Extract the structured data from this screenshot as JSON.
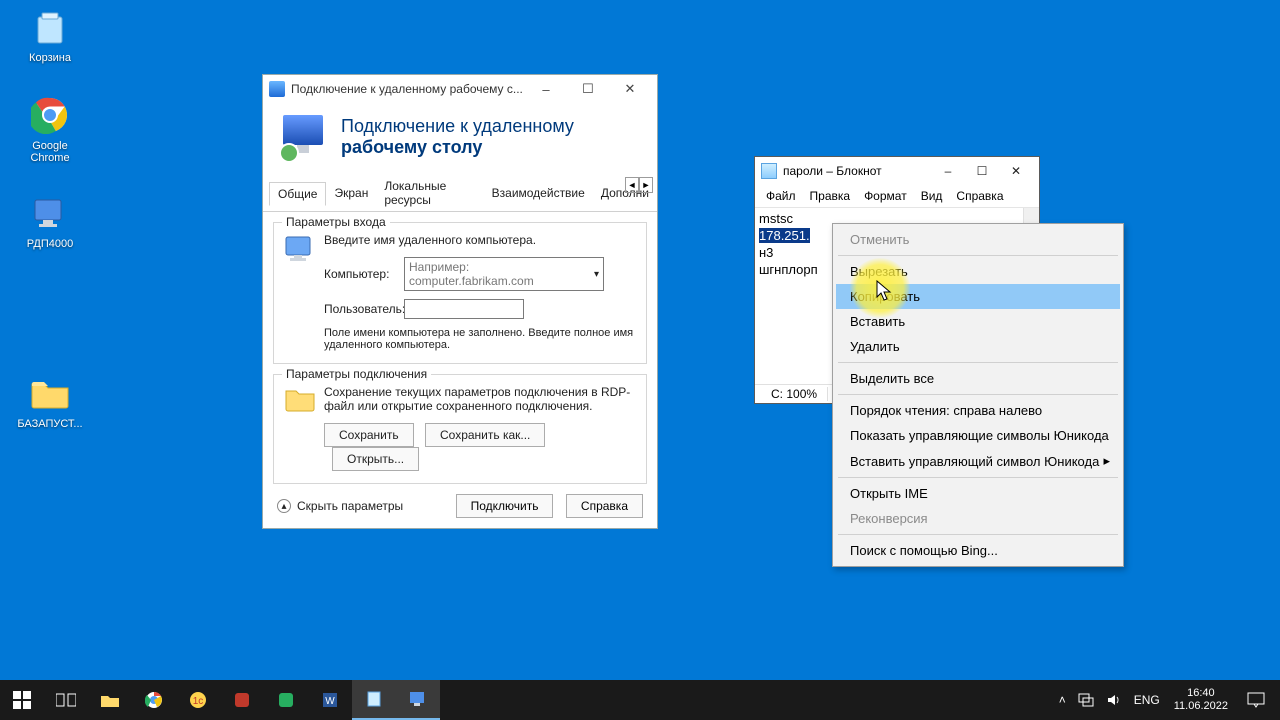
{
  "desktop": {
    "icons": [
      {
        "name": "recycle-bin",
        "label": "Корзина"
      },
      {
        "name": "chrome",
        "label": "Google Chrome"
      },
      {
        "name": "rdp4000",
        "label": "РДП4000"
      },
      {
        "name": "folder-baza",
        "label": "БАЗАПУСТ..."
      }
    ]
  },
  "rdp": {
    "title": "Подключение к удаленному рабочему с...",
    "header_line1": "Подключение к удаленному",
    "header_line2": "рабочему столу",
    "tabs": [
      "Общие",
      "Экран",
      "Локальные ресурсы",
      "Взаимодействие",
      "Дополни"
    ],
    "active_tab": 0,
    "group_login": {
      "legend": "Параметры входа",
      "intro": "Введите имя удаленного компьютера.",
      "computer_label": "Компьютер:",
      "computer_placeholder": "Например: computer.fabrikam.com",
      "user_label": "Пользователь:",
      "user_value": "",
      "hint": "Поле имени компьютера не заполнено. Введите полное имя удаленного компьютера."
    },
    "group_conn": {
      "legend": "Параметры подключения",
      "text": "Сохранение текущих параметров подключения в RDP-файл или открытие сохраненного подключения.",
      "save": "Сохранить",
      "save_as": "Сохранить как...",
      "open": "Открыть..."
    },
    "footer": {
      "hide": "Скрыть параметры",
      "connect": "Подключить",
      "help": "Справка"
    }
  },
  "notepad": {
    "title": "пароли – Блокнот",
    "menu": [
      "Файл",
      "Правка",
      "Формат",
      "Вид",
      "Справка"
    ],
    "lines": {
      "l1": "mstsc",
      "l2_sel": "178.251.",
      "l3": "н3",
      "l4": "шгнплорп"
    },
    "status": {
      "pos_label": "С:",
      "zoom": "100%"
    }
  },
  "context_menu": {
    "undo": "Отменить",
    "cut": "Вырезать",
    "copy": "Копировать",
    "paste": "Вставить",
    "delete": "Удалить",
    "select_all": "Выделить все",
    "rtl": "Порядок чтения: справа налево",
    "show_unicode": "Показать управляющие символы Юникода",
    "insert_unicode": "Вставить управляющий символ Юникода",
    "open_ime": "Открыть IME",
    "reconv": "Реконверсия",
    "bing": "Поиск с помощью Bing..."
  },
  "taskbar": {
    "lang": "ENG",
    "time": "16:40",
    "date": "11.06.2022"
  }
}
